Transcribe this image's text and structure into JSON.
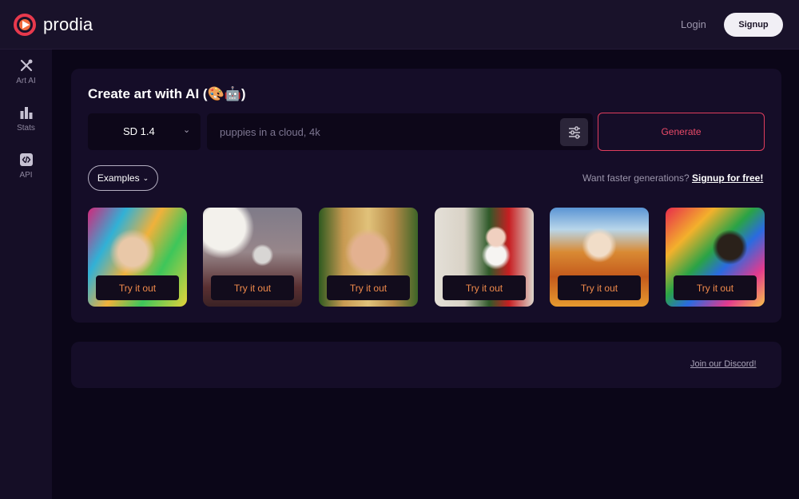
{
  "header": {
    "brand": "prodia",
    "login_label": "Login",
    "signup_label": "Signup"
  },
  "sidebar": {
    "items": [
      {
        "label": "Art AI",
        "icon": "brush-icon"
      },
      {
        "label": "Stats",
        "icon": "bar-chart-icon"
      },
      {
        "label": "API",
        "icon": "code-icon"
      }
    ]
  },
  "main": {
    "title": "Create art with AI (🎨🤖)",
    "model_select": {
      "value": "SD 1.4"
    },
    "prompt": {
      "placeholder": "puppies in a cloud, 4k",
      "value": ""
    },
    "generate_label": "Generate",
    "examples_label": "Examples",
    "faster_text": "Want faster generations?",
    "faster_link": "Signup for free!",
    "cards": [
      {
        "label": "Try it out"
      },
      {
        "label": "Try it out"
      },
      {
        "label": "Try it out"
      },
      {
        "label": "Try it out"
      },
      {
        "label": "Try it out"
      },
      {
        "label": "Try it out"
      }
    ]
  },
  "footer": {
    "discord_link": "Join our Discord!"
  },
  "colors": {
    "background": "#0b0618",
    "panel": "#150d28",
    "accent": "#e03d5d",
    "card_button_text": "#f08a4b"
  }
}
